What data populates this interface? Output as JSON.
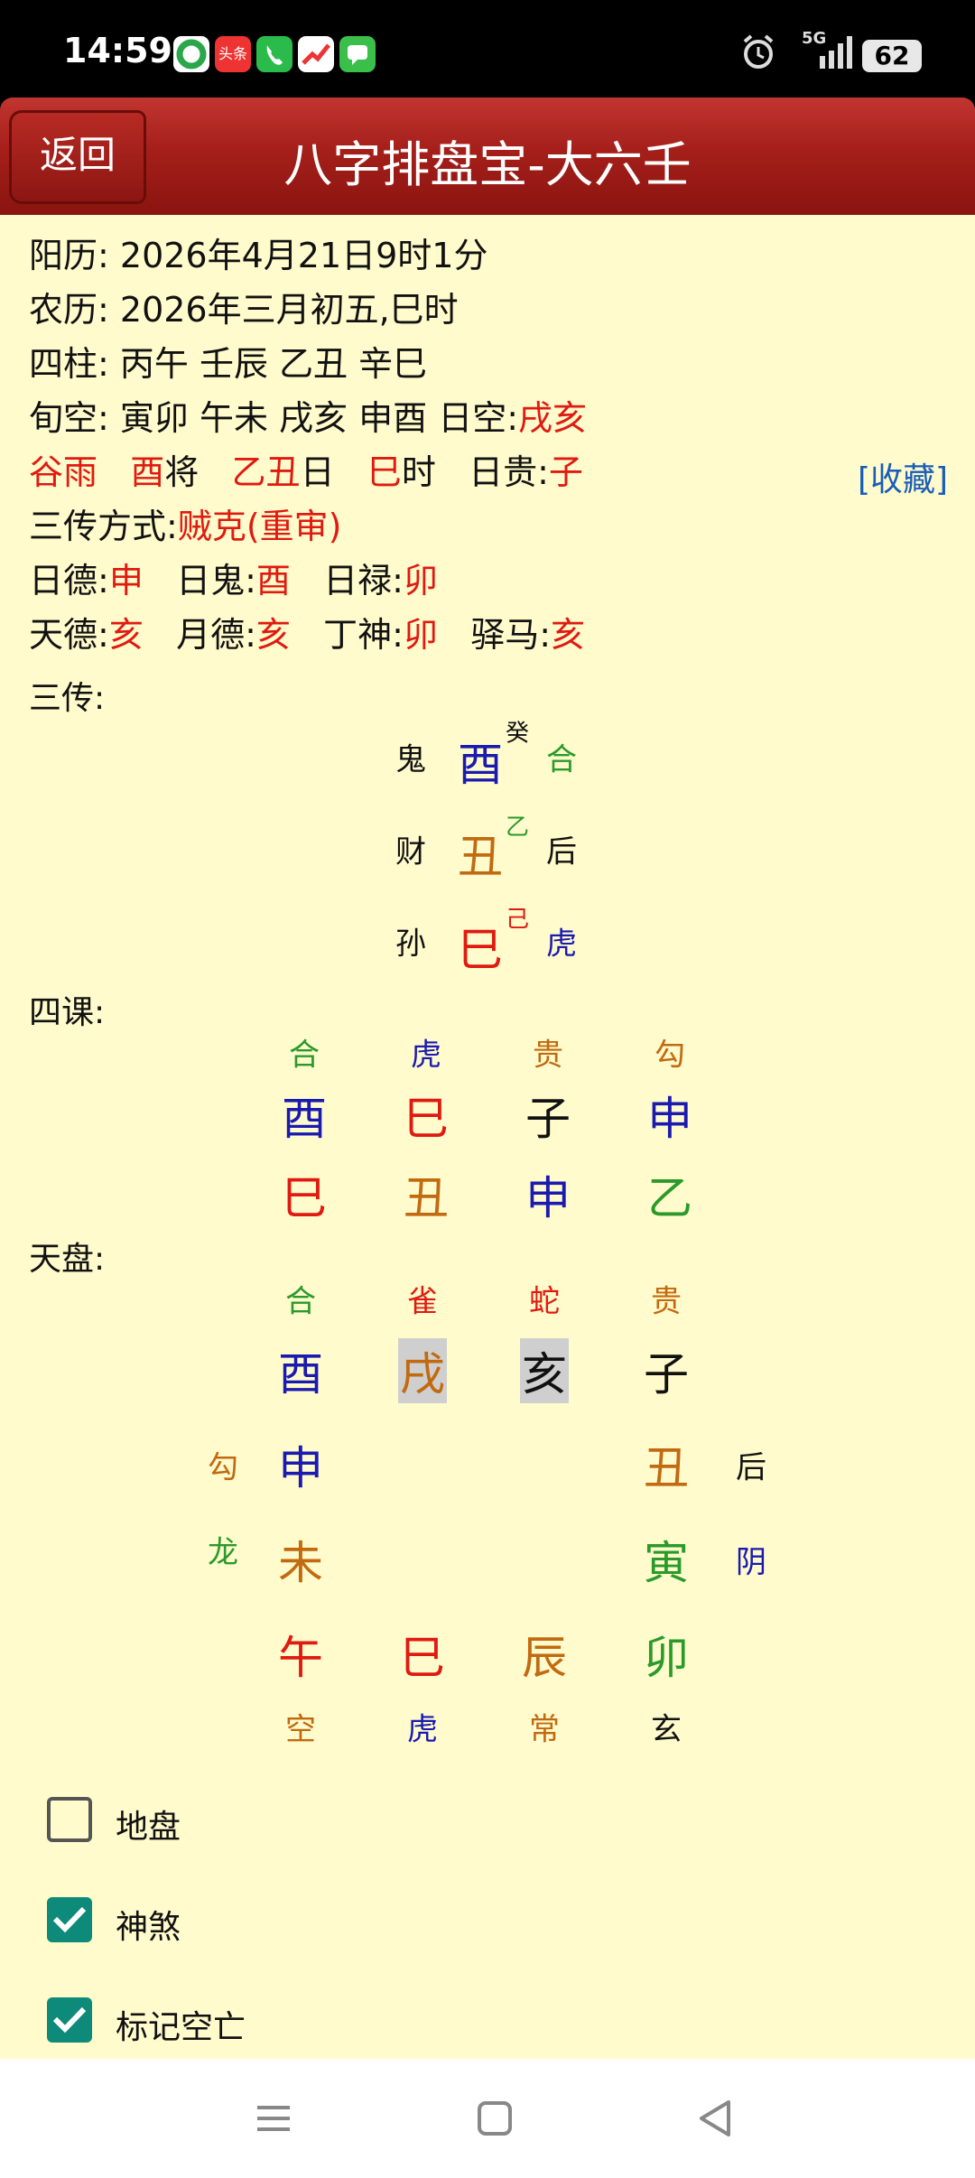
{
  "status_bar": {
    "time": "14:59",
    "network": "5G",
    "battery": "62",
    "app_icons": [
      "photos-app-icon",
      "toutiao-app-icon",
      "phone-app-icon",
      "stocks-app-icon",
      "messages-app-icon"
    ],
    "toutiao_label": "头条"
  },
  "header": {
    "back_label": "返回",
    "title": "八字排盘宝-大六壬"
  },
  "info": {
    "solar_label": "阳历: ",
    "solar_value": "2026年4月21日9时1分",
    "lunar_label": "农历: ",
    "lunar_value": "2026年三月初五,巳时",
    "pillars_label": "四柱: ",
    "pillars_value": "丙午  壬辰  乙丑  辛巳",
    "xunkong_label": "旬空: ",
    "xunkong_value": "寅卯  午未  戌亥  申酉  ",
    "rikong_label": "日空:",
    "rikong_value": "戌亥",
    "jieqi": "谷雨",
    "jiang_branch": "酉",
    "jiang_label": "将",
    "day_gz": "乙丑",
    "day_label": "日",
    "hour_branch": "巳",
    "hour_label": "时",
    "rigui_label": "日贵:",
    "rigui_value": "子",
    "method_label": "三传方式:",
    "method_value": "贼克(重审)",
    "ride_label": "日德:",
    "ride_value": "申",
    "rigui2_label": "日鬼:",
    "rigui2_value": "酉",
    "rilu_label": "日禄:",
    "rilu_value": "卯",
    "tiande_label": "天德:",
    "tiande_value": "亥",
    "yuede_label": "月德:",
    "yuede_value": "亥",
    "dingshen_label": "丁神:",
    "dingshen_value": "卯",
    "yima_label": "驿马:",
    "yima_value": "亥"
  },
  "sanchuan": {
    "label": "三传:",
    "favorite": "[收藏]",
    "rows": [
      {
        "relation": "鬼",
        "branch": "酉",
        "stem": "癸",
        "god": "合"
      },
      {
        "relation": "财",
        "branch": "丑",
        "stem": "乙",
        "god": "后"
      },
      {
        "relation": "孙",
        "branch": "巳",
        "stem": "己",
        "god": "虎"
      }
    ]
  },
  "sike": {
    "label": "四课:",
    "gods": [
      "合",
      "虎",
      "贵",
      "勾"
    ],
    "upper": [
      "酉",
      "巳",
      "子",
      "申"
    ],
    "lower": [
      "巳",
      "丑",
      "申",
      "乙"
    ]
  },
  "tianpan": {
    "label": "天盘:",
    "top_gods": [
      "合",
      "雀",
      "蛇",
      "贵"
    ],
    "top_branches": [
      "酉",
      "戌",
      "亥",
      "子"
    ],
    "left_gods": [
      "勾",
      "龙"
    ],
    "left_branches": [
      "申",
      "未"
    ],
    "right_branches": [
      "丑",
      "寅"
    ],
    "right_gods": [
      "后",
      "阴"
    ],
    "bottom_branches": [
      "午",
      "巳",
      "辰",
      "卯"
    ],
    "bottom_gods": [
      "空",
      "虎",
      "常",
      "玄"
    ]
  },
  "options": [
    {
      "label": "地盘",
      "checked": false
    },
    {
      "label": "神煞",
      "checked": true
    },
    {
      "label": "标记空亡",
      "checked": true
    }
  ],
  "colors": {
    "header": "#a51f1a",
    "background": "#fffbcc",
    "red": "#e01a10",
    "blue": "#1a1ab0",
    "orange": "#c26a10",
    "green": "#2a9a2a",
    "checkbox": "#0e8a7a",
    "link": "#1a5db8"
  }
}
